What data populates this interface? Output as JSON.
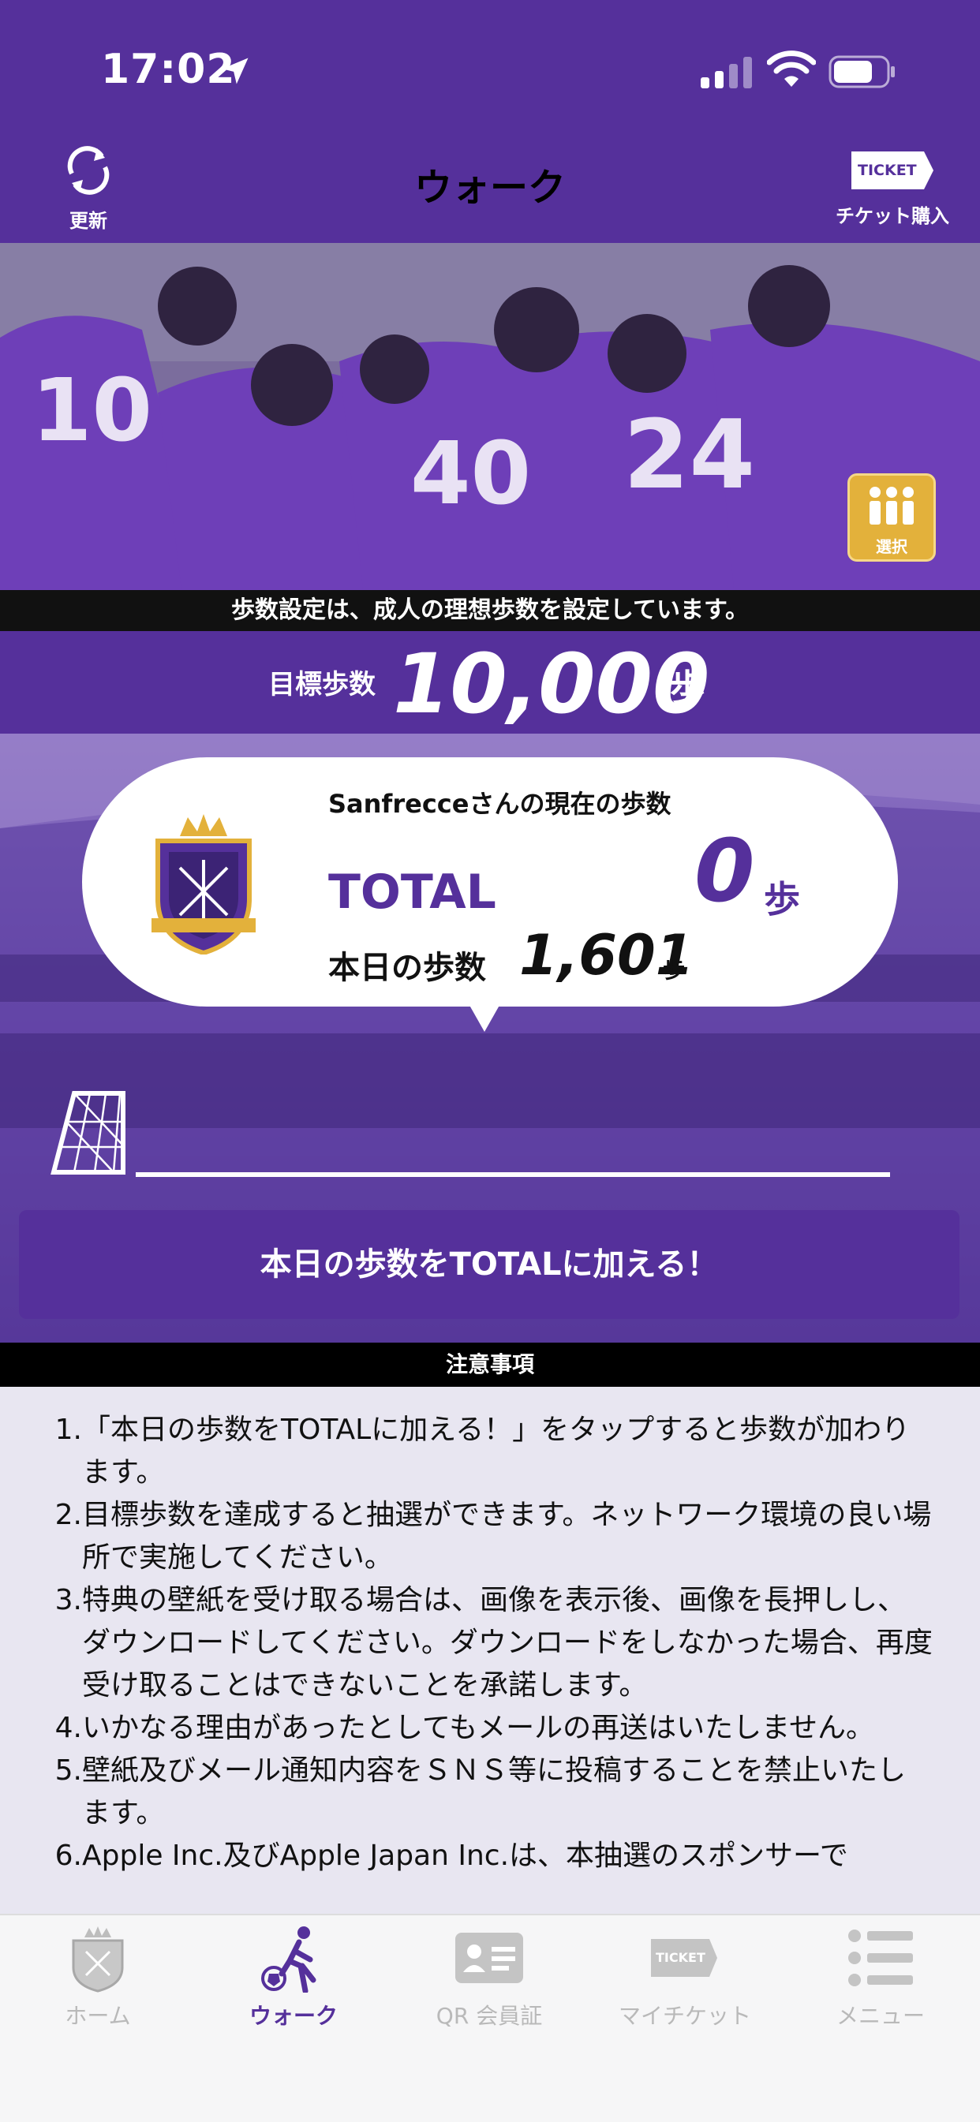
{
  "status_bar": {
    "time": "17:02"
  },
  "nav": {
    "refresh_label": "更新",
    "title": "ウォーク",
    "ticket_label": "チケット購入",
    "ticket_icon_text": "TICKET"
  },
  "hero": {
    "select_label": "選択"
  },
  "notice": "歩数設定は、成人の理想歩数を設定しています。",
  "goal": {
    "label": "目標歩数",
    "value": "10,000",
    "unit": "歩"
  },
  "card": {
    "heading": "Sanfrecceさんの現在の歩数",
    "total_label": "TOTAL",
    "total_value": "0",
    "total_unit": "歩",
    "today_label": "本日の歩数",
    "today_value": "1,601",
    "today_unit": "歩"
  },
  "progress": {
    "fraction": 0.0
  },
  "add_button": "本日の歩数をTOTALに加える！",
  "caution_title": "注意事項",
  "notes": [
    {
      "num": "1.",
      "text": "「本日の歩数をTOTALに加える！」をタップすると歩数が加わります。"
    },
    {
      "num": "2.",
      "text": "目標歩数を達成すると抽選ができます。ネットワーク環境の良い場所で実施してください。"
    },
    {
      "num": "3.",
      "text": "特典の壁紙を受け取る場合は、画像を表示後、画像を長押しし、ダウンロードしてください。ダウンロードをしなかった場合、再度受け取ることはできないことを承諾します。"
    },
    {
      "num": "4.",
      "text": "いかなる理由があったとしてもメールの再送はいたしません。"
    },
    {
      "num": "5.",
      "text": "壁紙及びメール通知内容をＳＮＳ等に投稿することを禁止いたします。"
    },
    {
      "num": "6.",
      "text": "Apple Inc.及びApple Japan Inc.は、本抽選のスポンサーで"
    }
  ],
  "tabs": [
    {
      "label": "ホーム",
      "icon": "home-crest-icon",
      "active": false
    },
    {
      "label": "ウォーク",
      "icon": "walk-icon",
      "active": true
    },
    {
      "label": "QR 会員証",
      "icon": "member-card-icon",
      "active": false
    },
    {
      "label": "マイチケット",
      "icon": "ticket-icon",
      "active": false
    },
    {
      "label": "メニュー",
      "icon": "menu-icon",
      "active": false
    }
  ],
  "colors": {
    "brand_purple": "#55309b",
    "gold": "#e3b13b",
    "notes_bg": "#e8e6f1"
  }
}
